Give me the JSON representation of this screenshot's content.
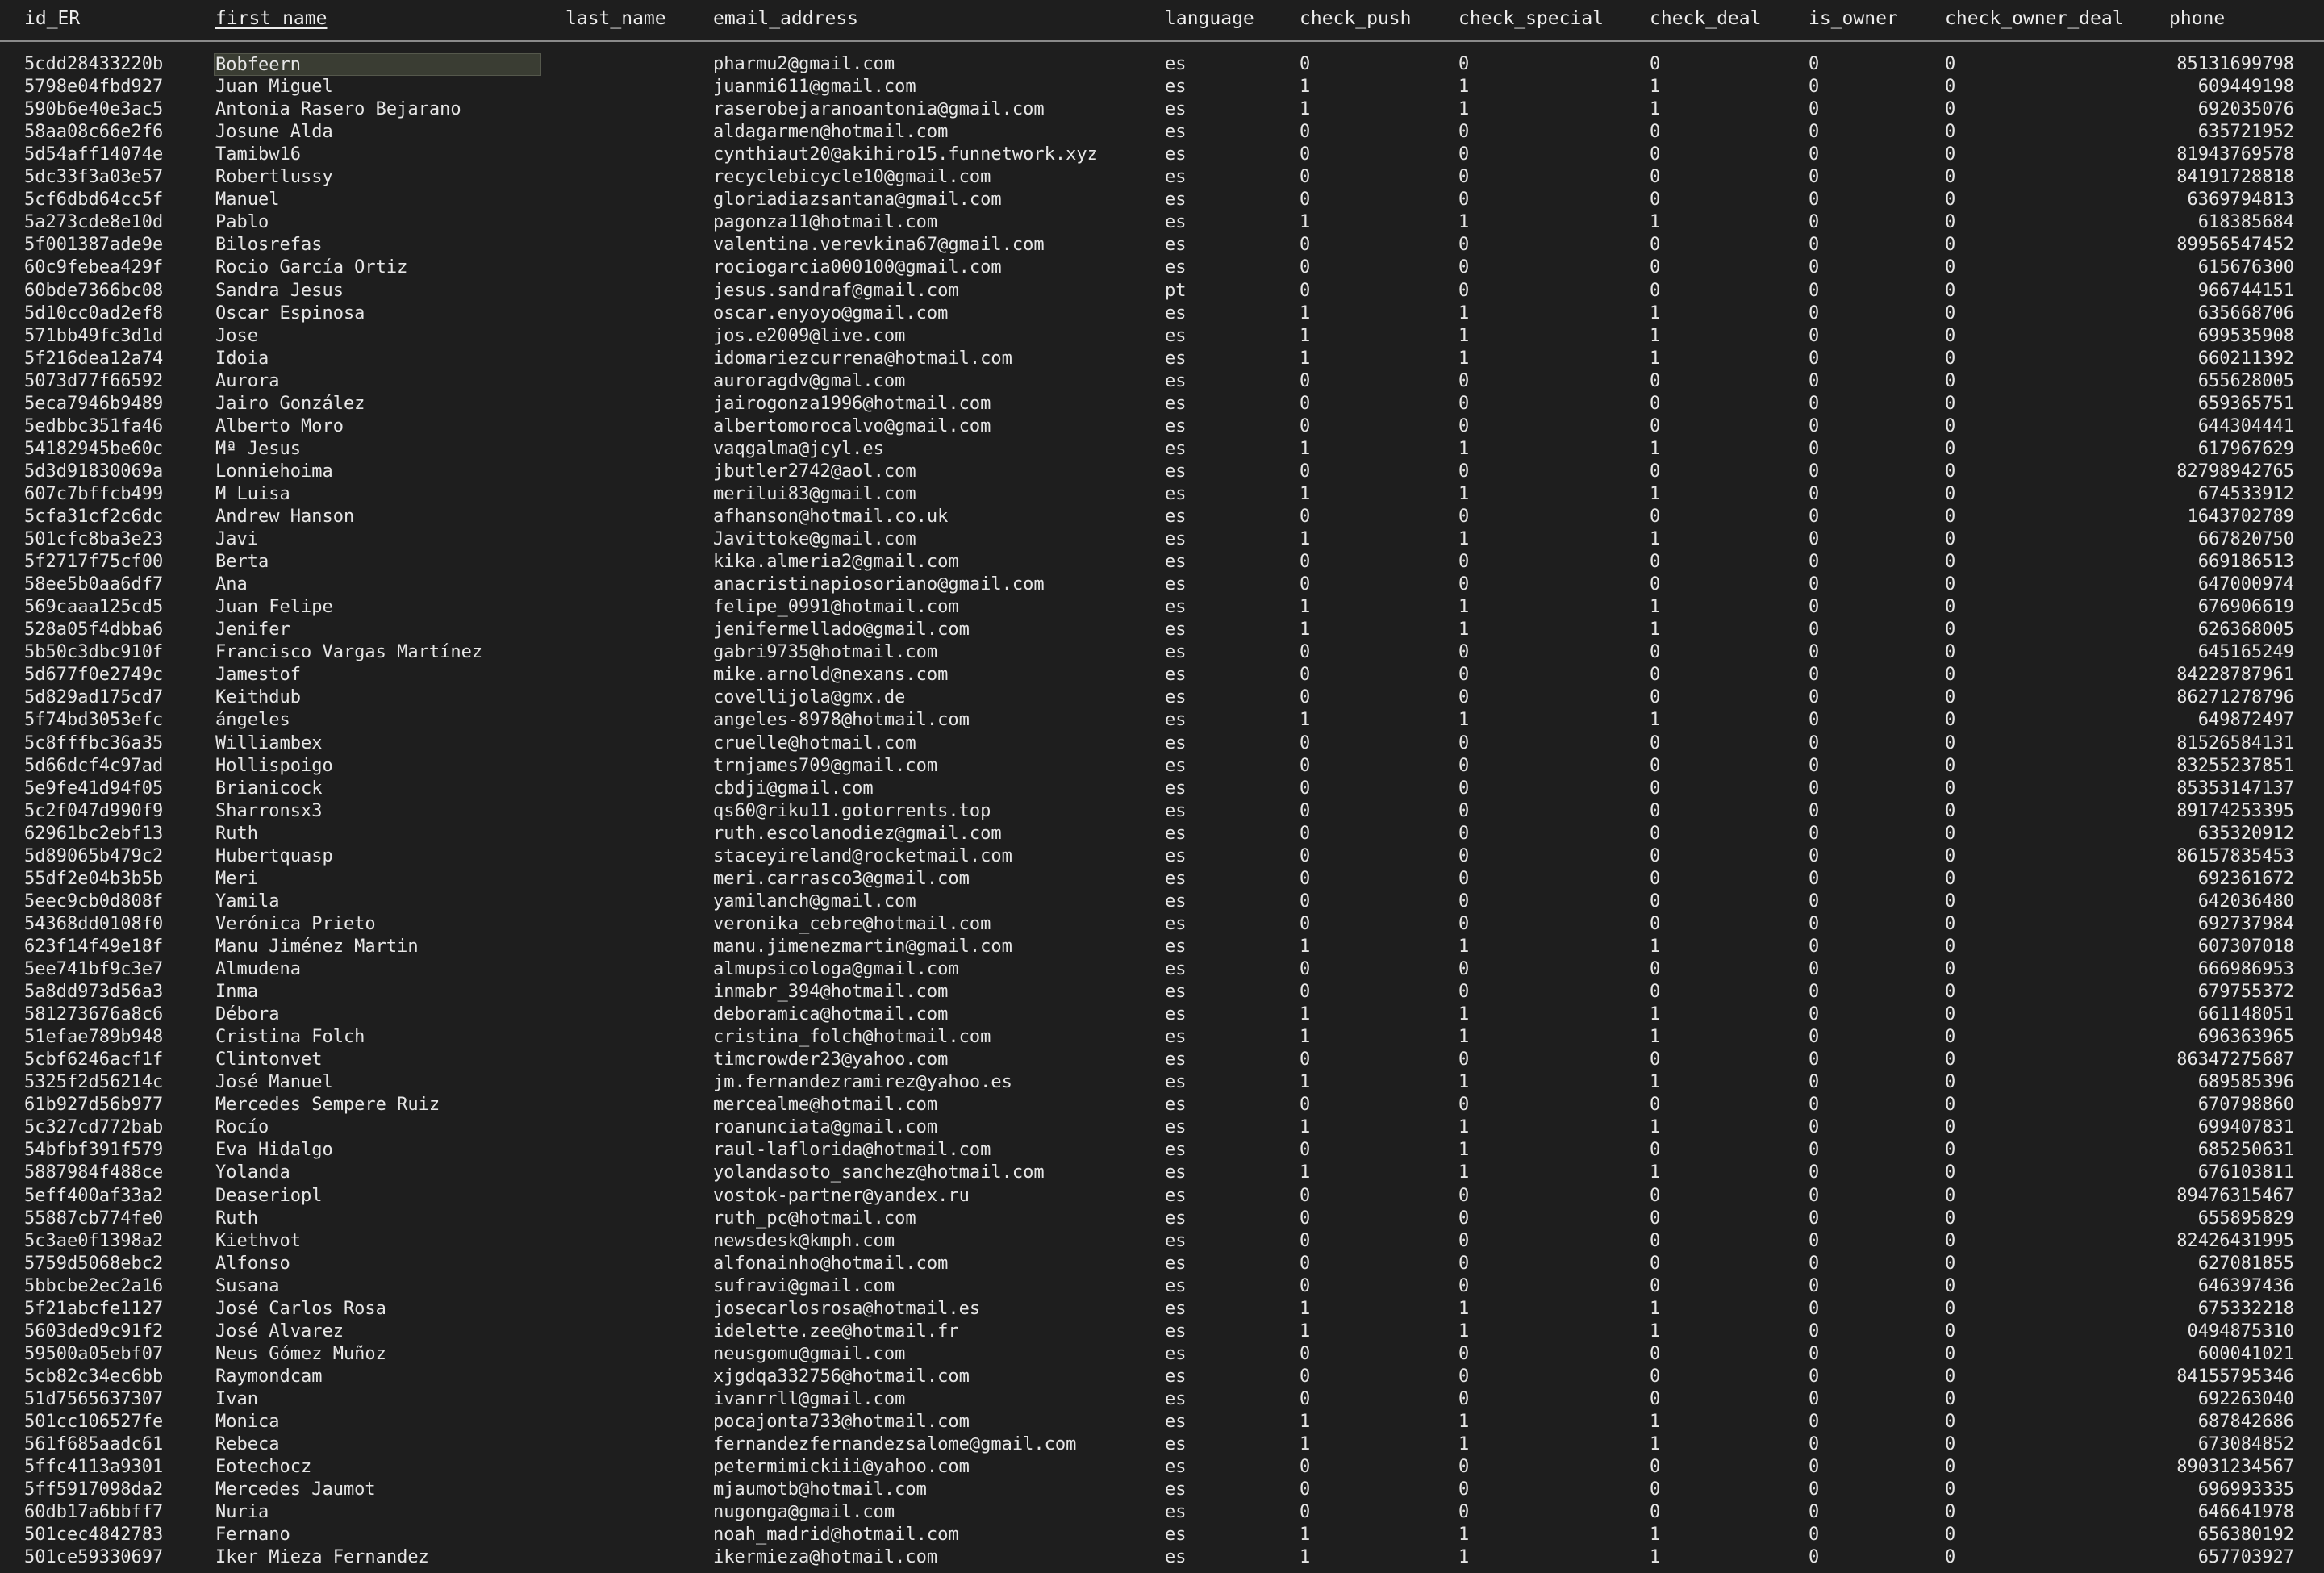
{
  "table": {
    "columns": [
      {
        "key": "id",
        "label": "id_ER",
        "sorted": false
      },
      {
        "key": "first",
        "label": "first_name",
        "sorted": true
      },
      {
        "key": "last",
        "label": "last_name",
        "sorted": false
      },
      {
        "key": "email",
        "label": "email_address",
        "sorted": false
      },
      {
        "key": "lang",
        "label": "language",
        "sorted": false
      },
      {
        "key": "push",
        "label": "check_push",
        "sorted": false
      },
      {
        "key": "special",
        "label": "check_special",
        "sorted": false
      },
      {
        "key": "deal",
        "label": "check_deal",
        "sorted": false
      },
      {
        "key": "owner",
        "label": "is_owner",
        "sorted": false
      },
      {
        "key": "ownerdeal",
        "label": "check_owner_deal",
        "sorted": false
      },
      {
        "key": "phone",
        "label": "phone",
        "sorted": false
      }
    ],
    "selected_row": 0,
    "selected_column": "first",
    "rows": [
      [
        "5cdd28433220b",
        "Bobfeern",
        "",
        "pharmu2@gmail.com",
        "es",
        "0",
        "0",
        "0",
        "0",
        "0",
        "85131699798"
      ],
      [
        "5798e04fbd927",
        "Juan Miguel",
        "",
        "juanmi611@gmail.com",
        "es",
        "1",
        "1",
        "1",
        "0",
        "0",
        "609449198"
      ],
      [
        "590b6e40e3ac5",
        "Antonia Rasero Bejarano",
        "",
        "raserobejaranoantonia@gmail.com",
        "es",
        "1",
        "1",
        "1",
        "0",
        "0",
        "692035076"
      ],
      [
        "58aa08c66e2f6",
        "Josune Alda",
        "",
        "aldagarmen@hotmail.com",
        "es",
        "0",
        "0",
        "0",
        "0",
        "0",
        "635721952"
      ],
      [
        "5d54aff14074e",
        "Tamibw16",
        "",
        "cynthiaut20@akihiro15.funnetwork.xyz",
        "es",
        "0",
        "0",
        "0",
        "0",
        "0",
        "81943769578"
      ],
      [
        "5dc33f3a03e57",
        "Robertlussy",
        "",
        "recyclebicycle10@gmail.com",
        "es",
        "0",
        "0",
        "0",
        "0",
        "0",
        "84191728818"
      ],
      [
        "5cf6dbd64cc5f",
        "Manuel",
        "",
        "gloriadiazsantana@gmail.com",
        "es",
        "0",
        "0",
        "0",
        "0",
        "0",
        "6369794813"
      ],
      [
        "5a273cde8e10d",
        "Pablo",
        "",
        "pagonza11@hotmail.com",
        "es",
        "1",
        "1",
        "1",
        "0",
        "0",
        "618385684"
      ],
      [
        "5f001387ade9e",
        "Bilosrefas",
        "",
        "valentina.verevkina67@gmail.com",
        "es",
        "0",
        "0",
        "0",
        "0",
        "0",
        "89956547452"
      ],
      [
        "60c9febea429f",
        "Rocio García Ortiz",
        "",
        "rociogarcia000100@gmail.com",
        "es",
        "0",
        "0",
        "0",
        "0",
        "0",
        "615676300"
      ],
      [
        "60bde7366bc08",
        "Sandra Jesus",
        "",
        "jesus.sandraf@gmail.com",
        "pt",
        "0",
        "0",
        "0",
        "0",
        "0",
        "966744151"
      ],
      [
        "5d10cc0ad2ef8",
        "Oscar Espinosa",
        "",
        "oscar.enyoyo@gmail.com",
        "es",
        "1",
        "1",
        "1",
        "0",
        "0",
        "635668706"
      ],
      [
        "571bb49fc3d1d",
        "Jose",
        "",
        "jos.e2009@live.com",
        "es",
        "1",
        "1",
        "1",
        "0",
        "0",
        "699535908"
      ],
      [
        "5f216dea12a74",
        "Idoia",
        "",
        "idomariezcurrena@hotmail.com",
        "es",
        "1",
        "1",
        "1",
        "0",
        "0",
        "660211392"
      ],
      [
        "5073d77f66592",
        "Aurora",
        "",
        "auroragdv@gmal.com",
        "es",
        "0",
        "0",
        "0",
        "0",
        "0",
        "655628005"
      ],
      [
        "5eca7946b9489",
        "Jairo González",
        "",
        "jairogonza1996@hotmail.com",
        "es",
        "0",
        "0",
        "0",
        "0",
        "0",
        "659365751"
      ],
      [
        "5edbbc351fa46",
        "Alberto Moro",
        "",
        "albertomorocalvo@gmail.com",
        "es",
        "0",
        "0",
        "0",
        "0",
        "0",
        "644304441"
      ],
      [
        "54182945be60c",
        "Mª Jesus",
        "",
        "vaqgalma@jcyl.es",
        "es",
        "1",
        "1",
        "1",
        "0",
        "0",
        "617967629"
      ],
      [
        "5d3d91830069a",
        "Lonniehoima",
        "",
        "jbutler2742@aol.com",
        "es",
        "0",
        "0",
        "0",
        "0",
        "0",
        "82798942765"
      ],
      [
        "607c7bffcb499",
        "M Luisa",
        "",
        "merilui83@gmail.com",
        "es",
        "1",
        "1",
        "1",
        "0",
        "0",
        "674533912"
      ],
      [
        "5cfa31cf2c6dc",
        "Andrew Hanson",
        "",
        "afhanson@hotmail.co.uk",
        "es",
        "0",
        "0",
        "0",
        "0",
        "0",
        "1643702789"
      ],
      [
        "501cfc8ba3e23",
        "Javi",
        "",
        "Javittoke@gmail.com",
        "es",
        "1",
        "1",
        "1",
        "0",
        "0",
        "667820750"
      ],
      [
        "5f2717f75cf00",
        "Berta",
        "",
        "kika.almeria2@gmail.com",
        "es",
        "0",
        "0",
        "0",
        "0",
        "0",
        "669186513"
      ],
      [
        "58ee5b0aa6df7",
        "Ana",
        "",
        "anacristinapiosoriano@gmail.com",
        "es",
        "0",
        "0",
        "0",
        "0",
        "0",
        "647000974"
      ],
      [
        "569caaa125cd5",
        "Juan Felipe",
        "",
        "felipe_0991@hotmail.com",
        "es",
        "1",
        "1",
        "1",
        "0",
        "0",
        "676906619"
      ],
      [
        "528a05f4dbba6",
        "Jenifer",
        "",
        "jenifermellado@gmail.com",
        "es",
        "1",
        "1",
        "1",
        "0",
        "0",
        "626368005"
      ],
      [
        "5b50c3dbc910f",
        "Francisco Vargas Martínez",
        "",
        "gabri9735@hotmail.com",
        "es",
        "0",
        "0",
        "0",
        "0",
        "0",
        "645165249"
      ],
      [
        "5d677f0e2749c",
        "Jamestof",
        "",
        "mike.arnold@nexans.com",
        "es",
        "0",
        "0",
        "0",
        "0",
        "0",
        "84228787961"
      ],
      [
        "5d829ad175cd7",
        "Keithdub",
        "",
        "covellijola@gmx.de",
        "es",
        "0",
        "0",
        "0",
        "0",
        "0",
        "86271278796"
      ],
      [
        "5f74bd3053efc",
        "ángeles",
        "",
        "angeles-8978@hotmail.com",
        "es",
        "1",
        "1",
        "1",
        "0",
        "0",
        "649872497"
      ],
      [
        "5c8fffbc36a35",
        "Williambex",
        "",
        "cruelle@hotmail.com",
        "es",
        "0",
        "0",
        "0",
        "0",
        "0",
        "81526584131"
      ],
      [
        "5d66dcf4c97ad",
        "Hollispoigo",
        "",
        "trnjames709@gmail.com",
        "es",
        "0",
        "0",
        "0",
        "0",
        "0",
        "83255237851"
      ],
      [
        "5e9fe41d94f05",
        "Brianicock",
        "",
        "cbdji@gmail.com",
        "es",
        "0",
        "0",
        "0",
        "0",
        "0",
        "85353147137"
      ],
      [
        "5c2f047d990f9",
        "Sharronsx3",
        "",
        "qs60@riku11.gotorrents.top",
        "es",
        "0",
        "0",
        "0",
        "0",
        "0",
        "89174253395"
      ],
      [
        "62961bc2ebf13",
        "Ruth",
        "",
        "ruth.escolanodiez@gmail.com",
        "es",
        "0",
        "0",
        "0",
        "0",
        "0",
        "635320912"
      ],
      [
        "5d89065b479c2",
        "Hubertquasp",
        "",
        "staceyireland@rocketmail.com",
        "es",
        "0",
        "0",
        "0",
        "0",
        "0",
        "86157835453"
      ],
      [
        "55df2e04b3b5b",
        "Meri",
        "",
        "meri.carrasco3@gmail.com",
        "es",
        "0",
        "0",
        "0",
        "0",
        "0",
        "692361672"
      ],
      [
        "5eec9cb0d808f",
        "Yamila",
        "",
        "yamilanch@gmail.com",
        "es",
        "0",
        "0",
        "0",
        "0",
        "0",
        "642036480"
      ],
      [
        "54368dd0108f0",
        "Verónica Prieto",
        "",
        "veronika_cebre@hotmail.com",
        "es",
        "0",
        "0",
        "0",
        "0",
        "0",
        "692737984"
      ],
      [
        "623f14f49e18f",
        "Manu Jiménez Martin",
        "",
        "manu.jimenezmartin@gmail.com",
        "es",
        "1",
        "1",
        "1",
        "0",
        "0",
        "607307018"
      ],
      [
        "5ee741bf9c3e7",
        "Almudena",
        "",
        "almupsicologa@gmail.com",
        "es",
        "0",
        "0",
        "0",
        "0",
        "0",
        "666986953"
      ],
      [
        "5a8dd973d56a3",
        "Inma",
        "",
        "inmabr_394@hotmail.com",
        "es",
        "0",
        "0",
        "0",
        "0",
        "0",
        "679755372"
      ],
      [
        "581273676a8c6",
        "Débora",
        "",
        "deboramica@hotmail.com",
        "es",
        "1",
        "1",
        "1",
        "0",
        "0",
        "661148051"
      ],
      [
        "51efae789b948",
        "Cristina Folch",
        "",
        "cristina_folch@hotmail.com",
        "es",
        "1",
        "1",
        "1",
        "0",
        "0",
        "696363965"
      ],
      [
        "5cbf6246acf1f",
        "Clintonvet",
        "",
        "timcrowder23@yahoo.com",
        "es",
        "0",
        "0",
        "0",
        "0",
        "0",
        "86347275687"
      ],
      [
        "5325f2d56214c",
        "José Manuel",
        "",
        "jm.fernandezramirez@yahoo.es",
        "es",
        "1",
        "1",
        "1",
        "0",
        "0",
        "689585396"
      ],
      [
        "61b927d56b977",
        "Mercedes Sempere Ruiz",
        "",
        "mercealme@hotmail.com",
        "es",
        "0",
        "0",
        "0",
        "0",
        "0",
        "670798860"
      ],
      [
        "5c327cd772bab",
        "Rocío",
        "",
        "roanunciata@gmail.com",
        "es",
        "1",
        "1",
        "1",
        "0",
        "0",
        "699407831"
      ],
      [
        "54bfbf391f579",
        "Eva Hidalgo",
        "",
        "raul-laflorida@hotmail.com",
        "es",
        "0",
        "1",
        "0",
        "0",
        "0",
        "685250631"
      ],
      [
        "5887984f488ce",
        "Yolanda",
        "",
        "yolandasoto_sanchez@hotmail.com",
        "es",
        "1",
        "1",
        "1",
        "0",
        "0",
        "676103811"
      ],
      [
        "5eff400af33a2",
        "Deaseriopl",
        "",
        "vostok-partner@yandex.ru",
        "es",
        "0",
        "0",
        "0",
        "0",
        "0",
        "89476315467"
      ],
      [
        "55887cb774fe0",
        "Ruth",
        "",
        "ruth_pc@hotmail.com",
        "es",
        "0",
        "0",
        "0",
        "0",
        "0",
        "655895829"
      ],
      [
        "5c3ae0f1398a2",
        "Kiethvot",
        "",
        "newsdesk@kmph.com",
        "es",
        "0",
        "0",
        "0",
        "0",
        "0",
        "82426431995"
      ],
      [
        "5759d5068ebc2",
        "Alfonso",
        "",
        "alfonainho@hotmail.com",
        "es",
        "0",
        "0",
        "0",
        "0",
        "0",
        "627081855"
      ],
      [
        "5bbcbe2ec2a16",
        "Susana",
        "",
        "sufravi@gmail.com",
        "es",
        "0",
        "0",
        "0",
        "0",
        "0",
        "646397436"
      ],
      [
        "5f21abcfe1127",
        "José Carlos Rosa",
        "",
        "josecarlosrosa@hotmail.es",
        "es",
        "1",
        "1",
        "1",
        "0",
        "0",
        "675332218"
      ],
      [
        "5603ded9c91f2",
        "José Alvarez",
        "",
        "idelette.zee@hotmail.fr",
        "es",
        "1",
        "1",
        "1",
        "0",
        "0",
        "0494875310"
      ],
      [
        "59500a05ebf07",
        "Neus Gómez Muñoz",
        "",
        "neusgomu@gmail.com",
        "es",
        "0",
        "0",
        "0",
        "0",
        "0",
        "600041021"
      ],
      [
        "5cb82c34ec6bb",
        "Raymondcam",
        "",
        "xjgdqa332756@hotmail.com",
        "es",
        "0",
        "0",
        "0",
        "0",
        "0",
        "84155795346"
      ],
      [
        "51d7565637307",
        "Ivan",
        "",
        "ivanrrll@gmail.com",
        "es",
        "0",
        "0",
        "0",
        "0",
        "0",
        "692263040"
      ],
      [
        "501cc106527fe",
        "Monica",
        "",
        "pocajonta733@hotmail.com",
        "es",
        "1",
        "1",
        "1",
        "0",
        "0",
        "687842686"
      ],
      [
        "561f685aadc61",
        "Rebeca",
        "",
        "fernandezfernandezsalome@gmail.com",
        "es",
        "1",
        "1",
        "1",
        "0",
        "0",
        "673084852"
      ],
      [
        "5ffc4113a9301",
        "Eotechocz",
        "",
        "petermimickiii@yahoo.com",
        "es",
        "0",
        "0",
        "0",
        "0",
        "0",
        "89031234567"
      ],
      [
        "5ff5917098da2",
        "Mercedes Jaumot",
        "",
        "mjaumotb@hotmail.com",
        "es",
        "0",
        "0",
        "0",
        "0",
        "0",
        "696993335"
      ],
      [
        "60db17a6bbff7",
        "Nuria",
        "",
        "nugonga@gmail.com",
        "es",
        "0",
        "0",
        "0",
        "0",
        "0",
        "646641978"
      ],
      [
        "501cec4842783",
        "Fernano",
        "",
        "noah_madrid@hotmail.com",
        "es",
        "1",
        "1",
        "1",
        "0",
        "0",
        "656380192"
      ],
      [
        "501ce59330697",
        "Iker Mieza Fernandez",
        "",
        "ikermieza@hotmail.com",
        "es",
        "1",
        "1",
        "1",
        "0",
        "0",
        "657703927"
      ]
    ]
  }
}
